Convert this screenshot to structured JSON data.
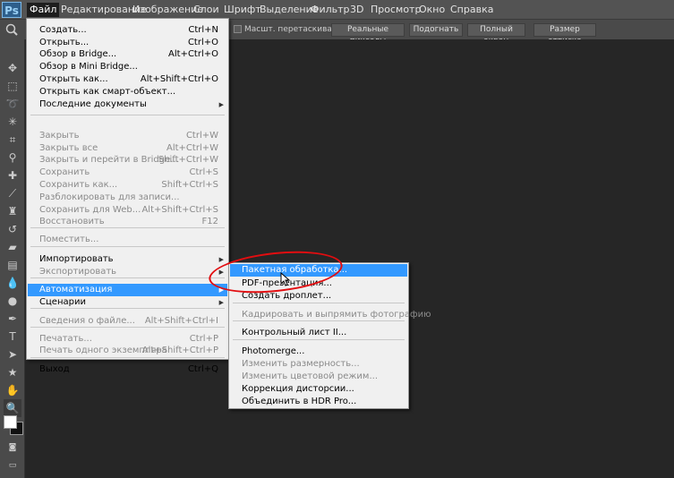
{
  "app": {
    "logo": "Ps"
  },
  "menubar": [
    "Файл",
    "Редактирование",
    "Изображение",
    "Слои",
    "Шрифт",
    "Выделение",
    "Фильтр",
    "3D",
    "Просмотр",
    "Окно",
    "Справка"
  ],
  "options": {
    "checkbox_label": "Масшт. перетаскиванием",
    "buttons": [
      "Реальные пикселы",
      "Подогнать",
      "Полный экран",
      "Размер оттиска"
    ]
  },
  "file_menu": [
    {
      "label": "Создать...",
      "shortcut": "Ctrl+N",
      "enabled": true
    },
    {
      "label": "Открыть...",
      "shortcut": "Ctrl+O",
      "enabled": true
    },
    {
      "label": "Обзор в Bridge...",
      "shortcut": "Alt+Ctrl+O",
      "enabled": true
    },
    {
      "label": "Обзор в Mini Bridge...",
      "shortcut": "",
      "enabled": true
    },
    {
      "label": "Открыть как...",
      "shortcut": "Alt+Shift+Ctrl+O",
      "enabled": true
    },
    {
      "label": "Открыть как смарт-объект...",
      "shortcut": "",
      "enabled": true
    },
    {
      "label": "Последние документы",
      "shortcut": "",
      "enabled": true,
      "submenu": true
    },
    {
      "label": "Закрыть",
      "shortcut": "Ctrl+W",
      "enabled": false
    },
    {
      "label": "Закрыть все",
      "shortcut": "Alt+Ctrl+W",
      "enabled": false
    },
    {
      "label": "Закрыть и перейти в Bridge...",
      "shortcut": "Shift+Ctrl+W",
      "enabled": false
    },
    {
      "label": "Сохранить",
      "shortcut": "Ctrl+S",
      "enabled": false
    },
    {
      "label": "Сохранить как...",
      "shortcut": "Shift+Ctrl+S",
      "enabled": false
    },
    {
      "label": "Разблокировать для записи...",
      "shortcut": "",
      "enabled": false
    },
    {
      "label": "Сохранить для Web...",
      "shortcut": "Alt+Shift+Ctrl+S",
      "enabled": false
    },
    {
      "label": "Восстановить",
      "shortcut": "F12",
      "enabled": false
    },
    {
      "label": "Поместить...",
      "shortcut": "",
      "enabled": false
    },
    {
      "label": "Импортировать",
      "shortcut": "",
      "enabled": true,
      "submenu": true
    },
    {
      "label": "Экспортировать",
      "shortcut": "",
      "enabled": false,
      "submenu": true
    },
    {
      "label": "Автоматизация",
      "shortcut": "",
      "enabled": true,
      "submenu": true,
      "highlighted": true
    },
    {
      "label": "Сценарии",
      "shortcut": "",
      "enabled": true,
      "submenu": true
    },
    {
      "label": "Сведения о файле...",
      "shortcut": "Alt+Shift+Ctrl+I",
      "enabled": false
    },
    {
      "label": "Печатать...",
      "shortcut": "Ctrl+P",
      "enabled": false
    },
    {
      "label": "Печать одного экземпляра",
      "shortcut": "Alt+Shift+Ctrl+P",
      "enabled": false
    },
    {
      "label": "Выход",
      "shortcut": "Ctrl+Q",
      "enabled": true
    }
  ],
  "automation_menu": [
    {
      "label": "Пакетная обработка...",
      "enabled": true,
      "highlighted": true
    },
    {
      "label": "PDF-презентация...",
      "enabled": true
    },
    {
      "label": "Создать дроплет...",
      "enabled": true
    },
    {
      "label": "Кадрировать и выпрямить фотографию",
      "enabled": false
    },
    {
      "label": "Контрольный лист II...",
      "enabled": true
    },
    {
      "label": "Photomerge...",
      "enabled": true
    },
    {
      "label": "Изменить размерность...",
      "enabled": false
    },
    {
      "label": "Изменить цветовой режим...",
      "enabled": false
    },
    {
      "label": "Коррекция дисторсии...",
      "enabled": true
    },
    {
      "label": "Объединить в HDR Pro...",
      "enabled": true
    }
  ],
  "colors": {
    "highlight": "#3399ff",
    "annotation": "#e20d10",
    "foreground": "#ffffff",
    "background": "#111111"
  }
}
